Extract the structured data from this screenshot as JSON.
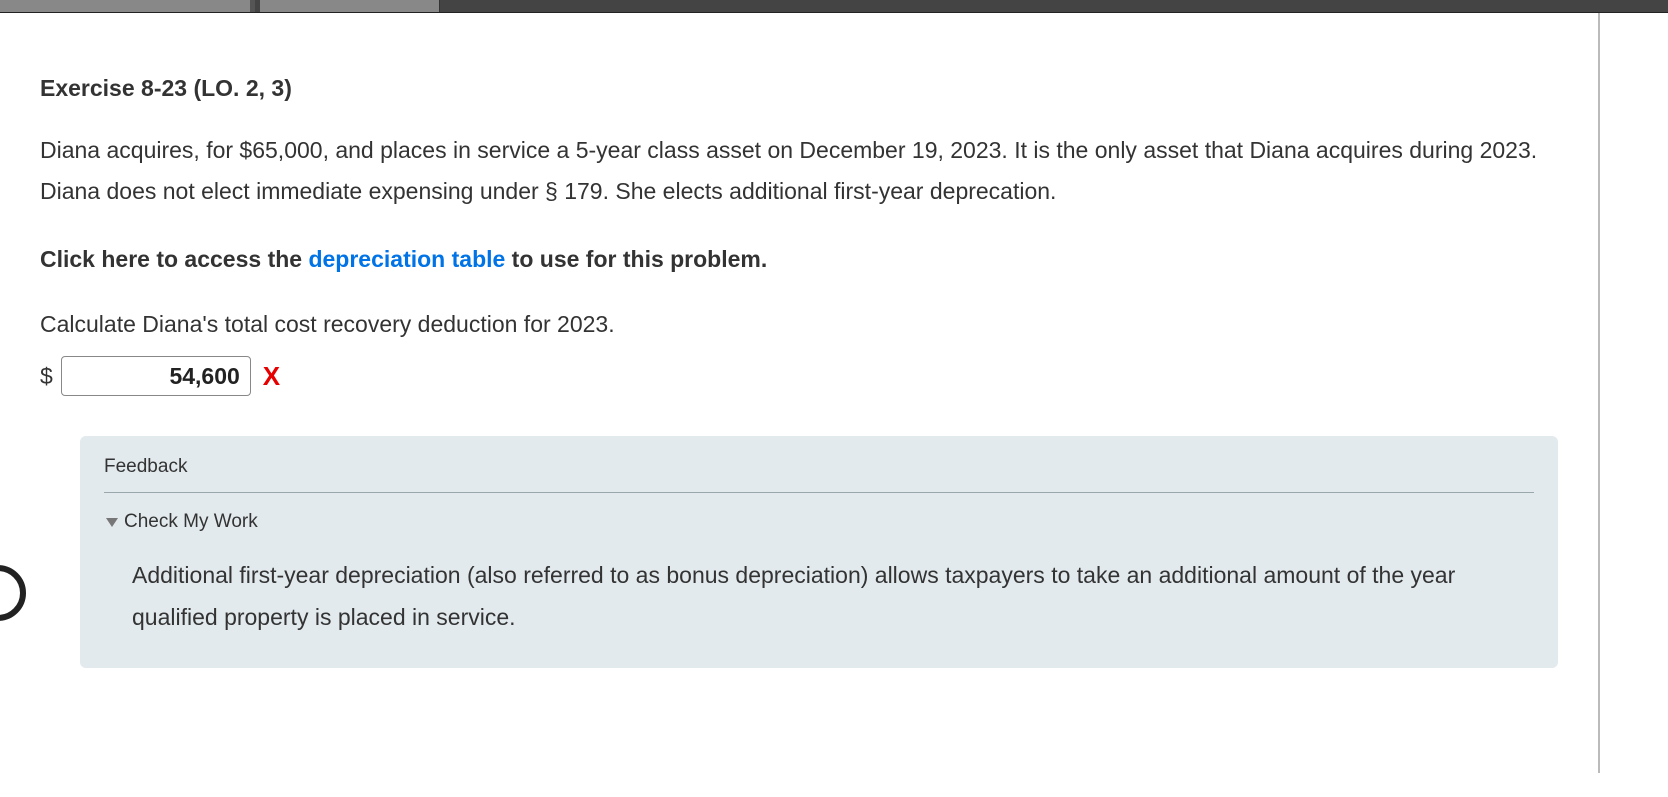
{
  "exercise": {
    "title": "Exercise 8-23 (LO. 2, 3)",
    "body": "Diana acquires, for $65,000, and places in service a 5-year class asset on December 19, 2023. It is the only asset that Diana acquires during 2023. Diana does not elect immediate expensing under § 179. She elects additional first-year deprecation.",
    "instruction_pre": "Click here to access the ",
    "instruction_link": "depreciation table",
    "instruction_post": " to use for this problem.",
    "prompt": "Calculate Diana's total cost recovery deduction for 2023.",
    "currency_symbol": "$",
    "answer_value": "54,600",
    "mark": "X"
  },
  "feedback": {
    "label": "Feedback",
    "check_label": "Check My Work",
    "text": "Additional first-year depreciation (also referred to as bonus depreciation) allows taxpayers to take an additional amount of the year qualified property is placed in service."
  }
}
